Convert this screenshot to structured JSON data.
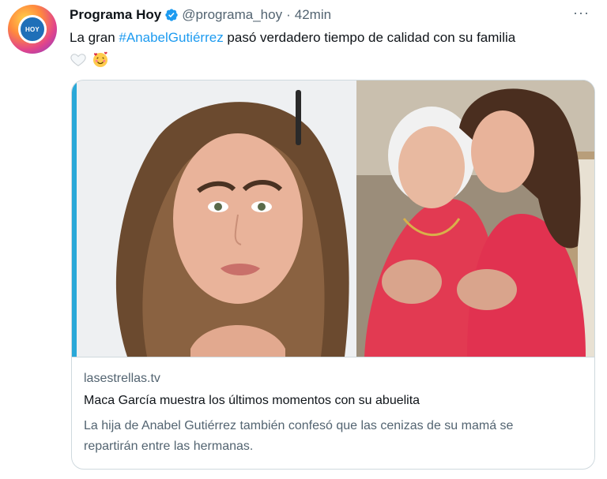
{
  "tweet": {
    "author": {
      "display_name": "Programa Hoy",
      "handle": "@programa_hoy",
      "separator": "·",
      "time": "42min",
      "verified": true,
      "avatar_icon": "programa-hoy-logo"
    },
    "more_label": "···",
    "text": {
      "prefix": "La gran ",
      "hashtag": "#AnabelGutiérrez",
      "suffix": " pasó verdadero tiempo de calidad con su familia",
      "emojis": [
        "white-heart-emoji",
        "smiling-face-with-hearts-emoji"
      ]
    },
    "card": {
      "image_icon": "link-card-photo",
      "domain": "lasestrellas.tv",
      "title": "Maca García muestra los últimos momentos con su abuelita",
      "description": "La hija de Anabel Gutiérrez también confesó que las cenizas de su mamá se repartirán entre las hermanas."
    }
  },
  "colors": {
    "link": "#1d9bf0",
    "secondary_text": "#536471",
    "primary_text": "#0f1419",
    "card_border": "#cfd9de"
  }
}
